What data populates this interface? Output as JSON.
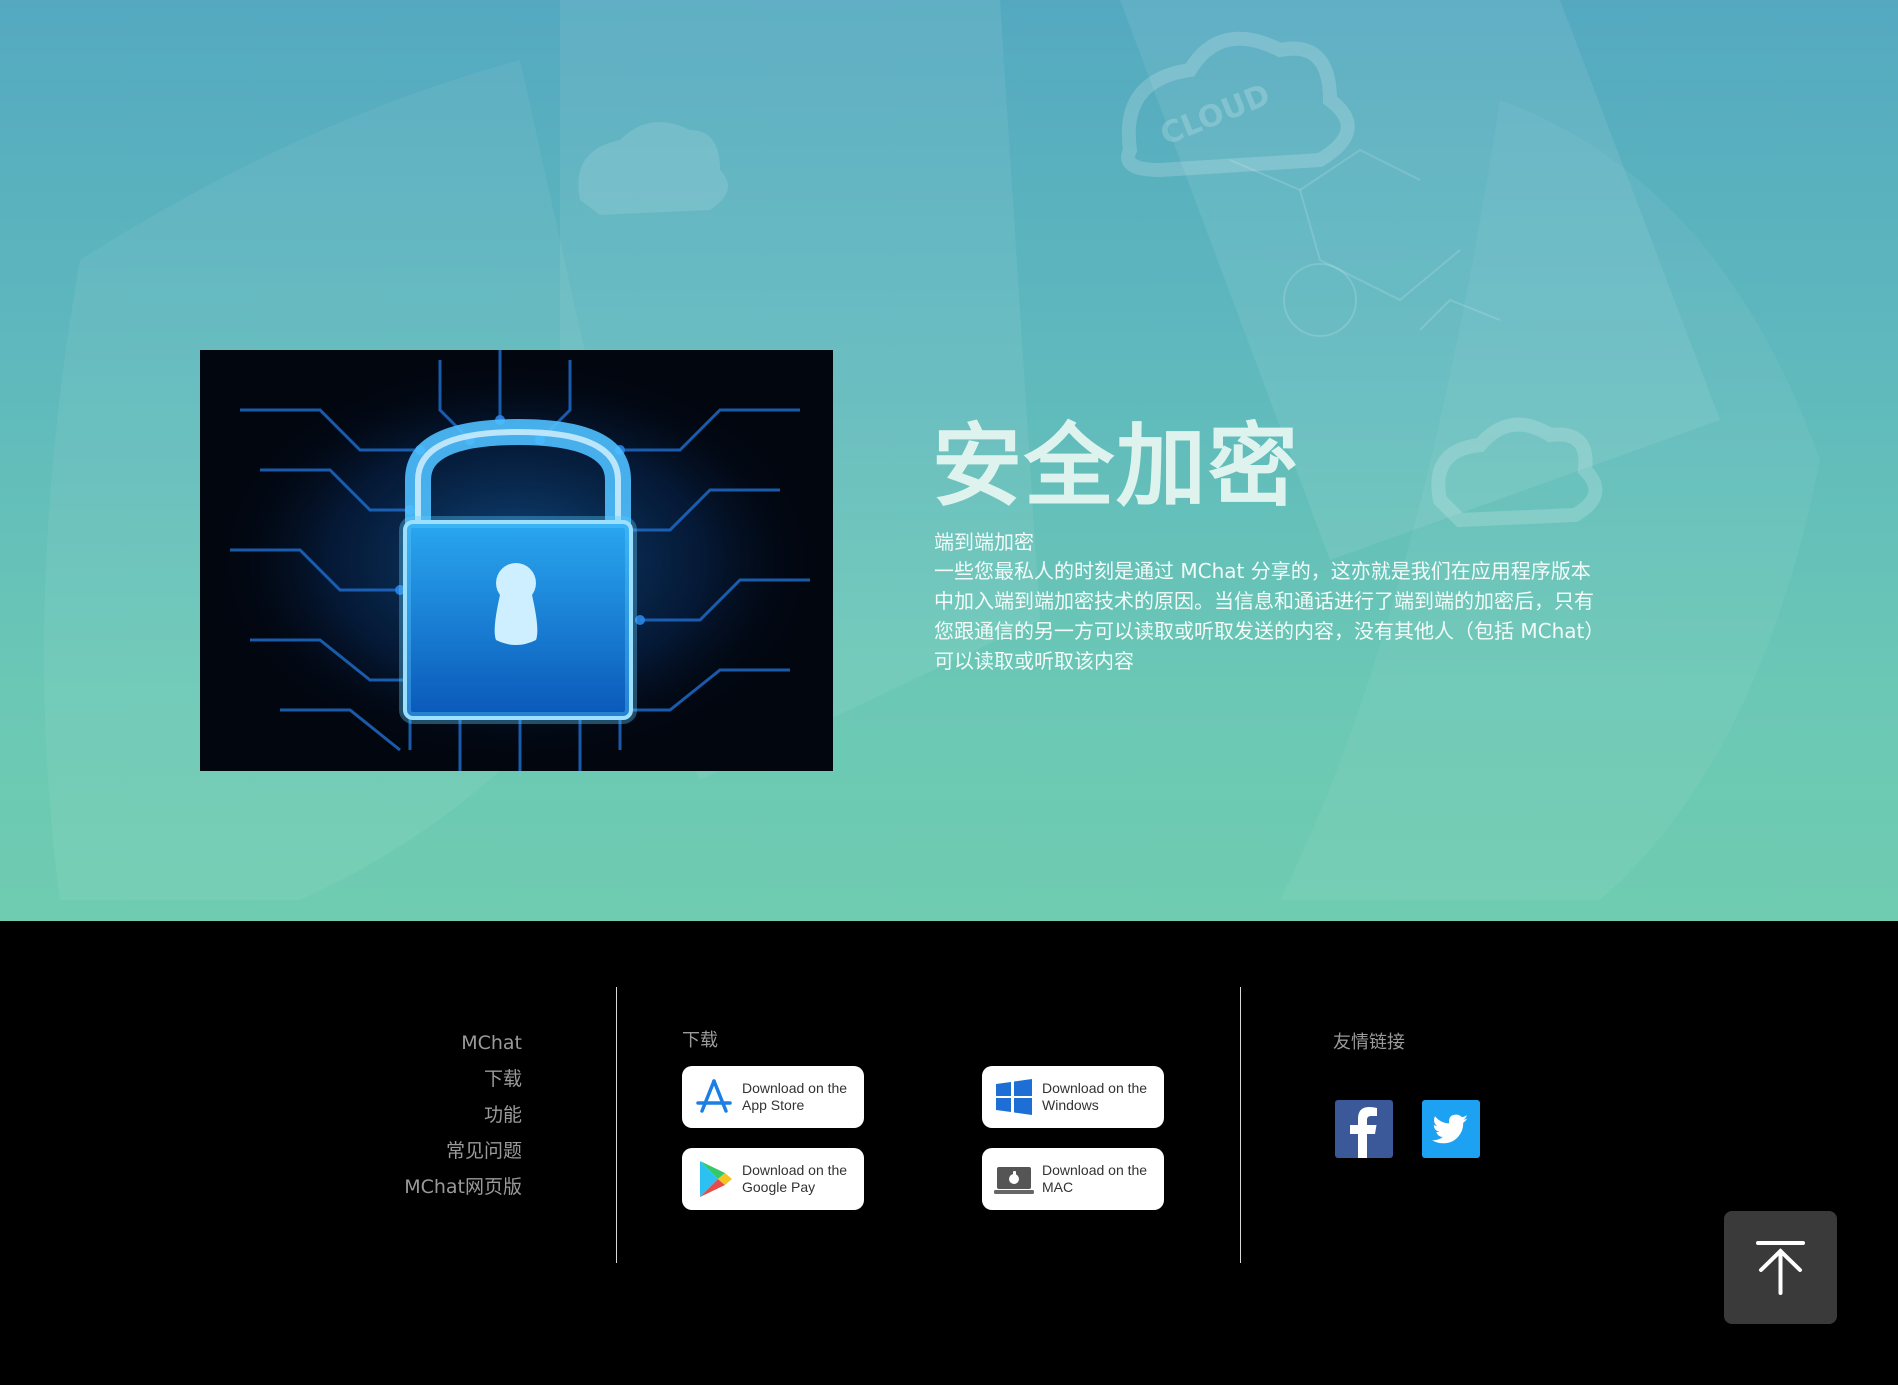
{
  "hero": {
    "title": "安全加密",
    "subtitle": "端到端加密",
    "description": "一些您最私人的时刻是通过 MChat 分享的，这亦就是我们在应用程序版本中加入端到端加密技术的原因。当信息和通话进行了端到端的加密后，只有您跟通信的另一方可以读取或听取发送的内容，没有其他人（包括 MChat）可以读取或听取该内容",
    "background_text": "CLOUD"
  },
  "footer": {
    "links": [
      "MChat",
      "下载",
      "功能",
      "常见问题",
      "MChat网页版"
    ],
    "download": {
      "heading": "下载",
      "buttons": [
        {
          "line1": "Download on the",
          "line2": "App Store",
          "icon": "app-store-icon"
        },
        {
          "line1": "Download on the",
          "line2": "Windows",
          "icon": "windows-icon"
        },
        {
          "line1": "Download on the",
          "line2": "Google Pay",
          "icon": "google-play-icon"
        },
        {
          "line1": "Download on the",
          "line2": "MAC",
          "icon": "mac-icon"
        }
      ]
    },
    "friends": {
      "heading": "友情链接",
      "social": [
        {
          "icon": "facebook-icon",
          "color": "#3b5998"
        },
        {
          "icon": "twitter-icon",
          "color": "#1da1f2"
        }
      ]
    },
    "back_to_top_icon": "arrow-up-to-top-icon"
  },
  "colors": {
    "hero_top": "#54a9c0",
    "hero_bottom": "#6fccb0",
    "footer_bg": "#000000",
    "footer_text": "#9a9a9a"
  }
}
